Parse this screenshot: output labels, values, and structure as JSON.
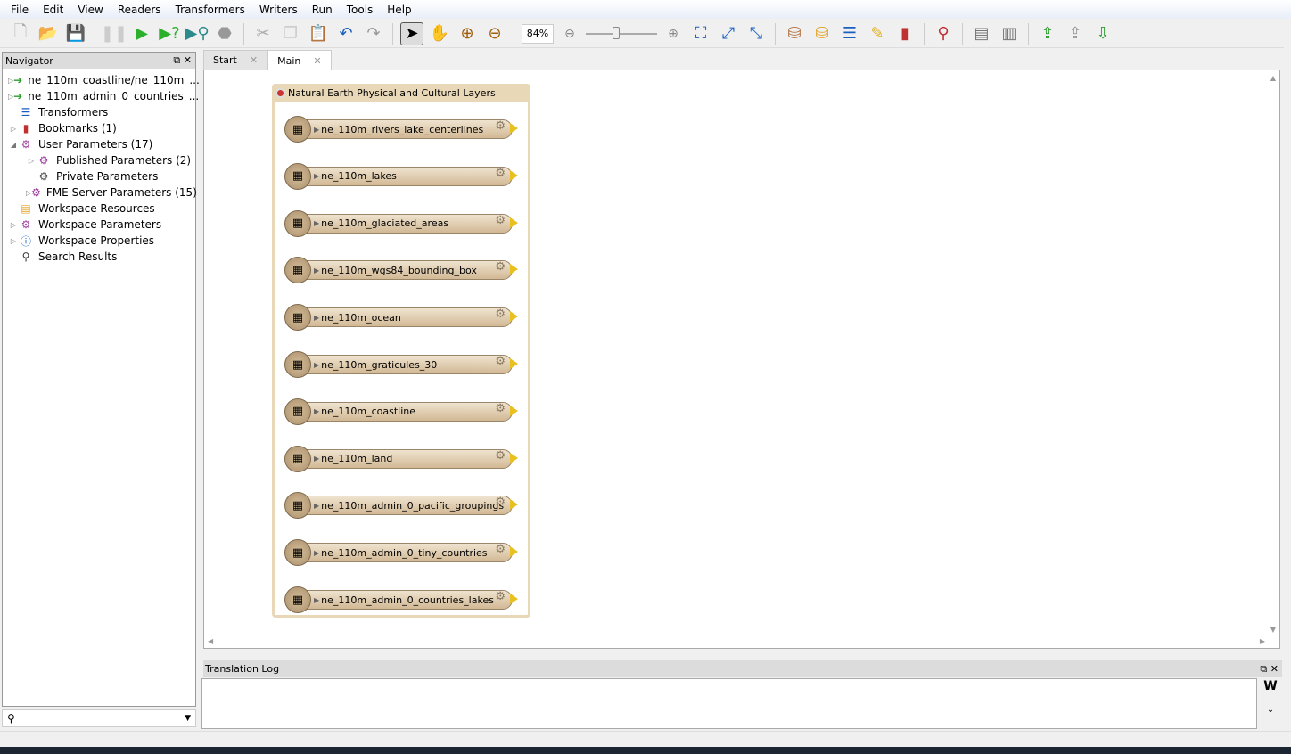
{
  "menu": [
    "File",
    "Edit",
    "View",
    "Readers",
    "Transformers",
    "Writers",
    "Run",
    "Tools",
    "Help"
  ],
  "toolbar": {
    "zoom": "84%",
    "buttons": [
      "new-file",
      "open",
      "save",
      "pause",
      "run",
      "run-prompt",
      "inspect",
      "stop",
      "cut",
      "copy",
      "paste",
      "undo",
      "redo",
      "select",
      "pan",
      "zoom-in",
      "zoom-out"
    ],
    "right_buttons": [
      "zoom-minus",
      "zoom-plus",
      "zoom-extents",
      "zoom-fit",
      "zoom-selection",
      "add-reader",
      "add-writer",
      "add-transformer",
      "add-annotation",
      "add-bookmark",
      "find",
      "align-left",
      "align-center",
      "import-feature-types",
      "update",
      "export"
    ]
  },
  "navigator": {
    "title": "Navigator",
    "items": [
      {
        "label": "ne_110m_coastline/ne_110m_...",
        "icon": "reader-icon",
        "arrow": "▷",
        "indent": 0
      },
      {
        "label": "ne_110m_admin_0_countries_...",
        "icon": "reader-icon",
        "arrow": "▷",
        "indent": 0
      },
      {
        "label": "Transformers",
        "icon": "transformers-icon",
        "arrow": "",
        "indent": 0
      },
      {
        "label": "Bookmarks (1)",
        "icon": "bookmark-icon",
        "arrow": "▷",
        "indent": 0
      },
      {
        "label": "User Parameters (17)",
        "icon": "gear-icon",
        "arrow": "◢",
        "indent": 0
      },
      {
        "label": "Published Parameters (2)",
        "icon": "gear-icon",
        "arrow": "▷",
        "indent": 1
      },
      {
        "label": "Private Parameters",
        "icon": "gear-lock-icon",
        "arrow": "",
        "indent": 1
      },
      {
        "label": "FME Server Parameters (15)",
        "icon": "gear-icon",
        "arrow": "▷",
        "indent": 1
      },
      {
        "label": "Workspace Resources",
        "icon": "folder-icon",
        "arrow": "",
        "indent": 0
      },
      {
        "label": "Workspace Parameters",
        "icon": "gear-icon",
        "arrow": "▷",
        "indent": 0
      },
      {
        "label": "Workspace Properties",
        "icon": "info-icon",
        "arrow": "▷",
        "indent": 0
      },
      {
        "label": "Search Results",
        "icon": "search-icon",
        "arrow": "",
        "indent": 0
      }
    ]
  },
  "tabs": [
    {
      "label": "Start",
      "active": false
    },
    {
      "label": "Main",
      "active": true
    }
  ],
  "bookmark": {
    "title": "Natural Earth Physical and Cultural Layers",
    "readers": [
      "ne_110m_rivers_lake_centerlines",
      "ne_110m_lakes",
      "ne_110m_glaciated_areas",
      "ne_110m_wgs84_bounding_box",
      "ne_110m_ocean",
      "ne_110m_graticules_30",
      "ne_110m_coastline",
      "ne_110m_land",
      "ne_110m_admin_0_pacific_groupings",
      "ne_110m_admin_0_tiny_countries",
      "ne_110m_admin_0_countries_lakes"
    ]
  },
  "log": {
    "title": "Translation Log"
  }
}
